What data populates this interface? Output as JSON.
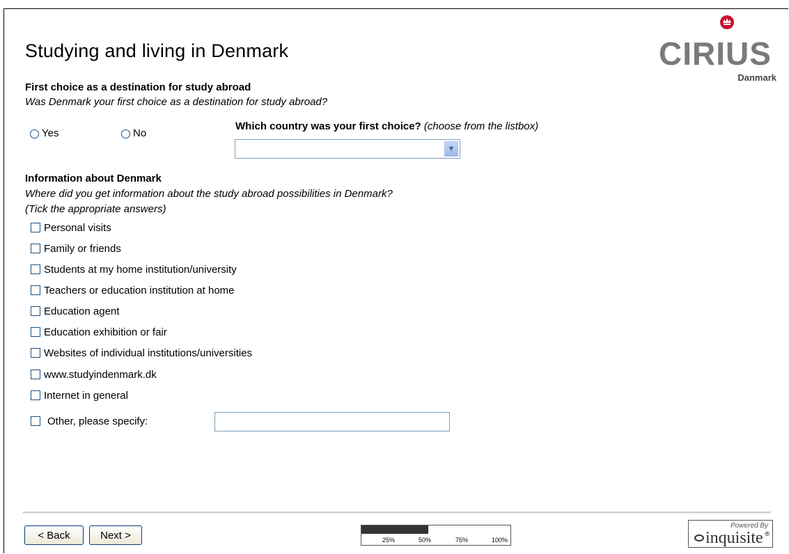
{
  "page": {
    "title": "Studying and living in Denmark"
  },
  "logo": {
    "name": "CIRIUS",
    "sub": "Danmark"
  },
  "q1": {
    "heading": "First choice as a destination for study abroad",
    "question": "Was Denmark your first choice as a destination for study abroad?",
    "options": [
      "Yes",
      "No"
    ]
  },
  "country": {
    "label": "Which country was your first choice?",
    "hint": "(choose from the listbox)",
    "selected": ""
  },
  "q2": {
    "heading": "Information about Denmark",
    "question": "Where did you get information about the study abroad possibilities in Denmark?",
    "hint": "(Tick the appropriate answers)",
    "options": [
      "Personal visits",
      "Family or friends",
      "Students at my home institution/university",
      "Teachers or education institution at home",
      "Education agent",
      "Education exhibition or fair",
      "Websites of individual institutions/universities",
      "www.studyindenmark.dk",
      "Internet in general"
    ],
    "other_label": "Other, please specify:",
    "other_value": ""
  },
  "nav": {
    "back": "< Back",
    "next": "Next >"
  },
  "progress": {
    "value": 0.45,
    "ticks": [
      "25%",
      "50%",
      "75%",
      "100%"
    ]
  },
  "powered": {
    "label": "Powered By",
    "brand": "inquisite",
    "reg": "®"
  },
  "colors": {
    "control_border": "#1c5180",
    "input_border": "#7f9db9"
  }
}
